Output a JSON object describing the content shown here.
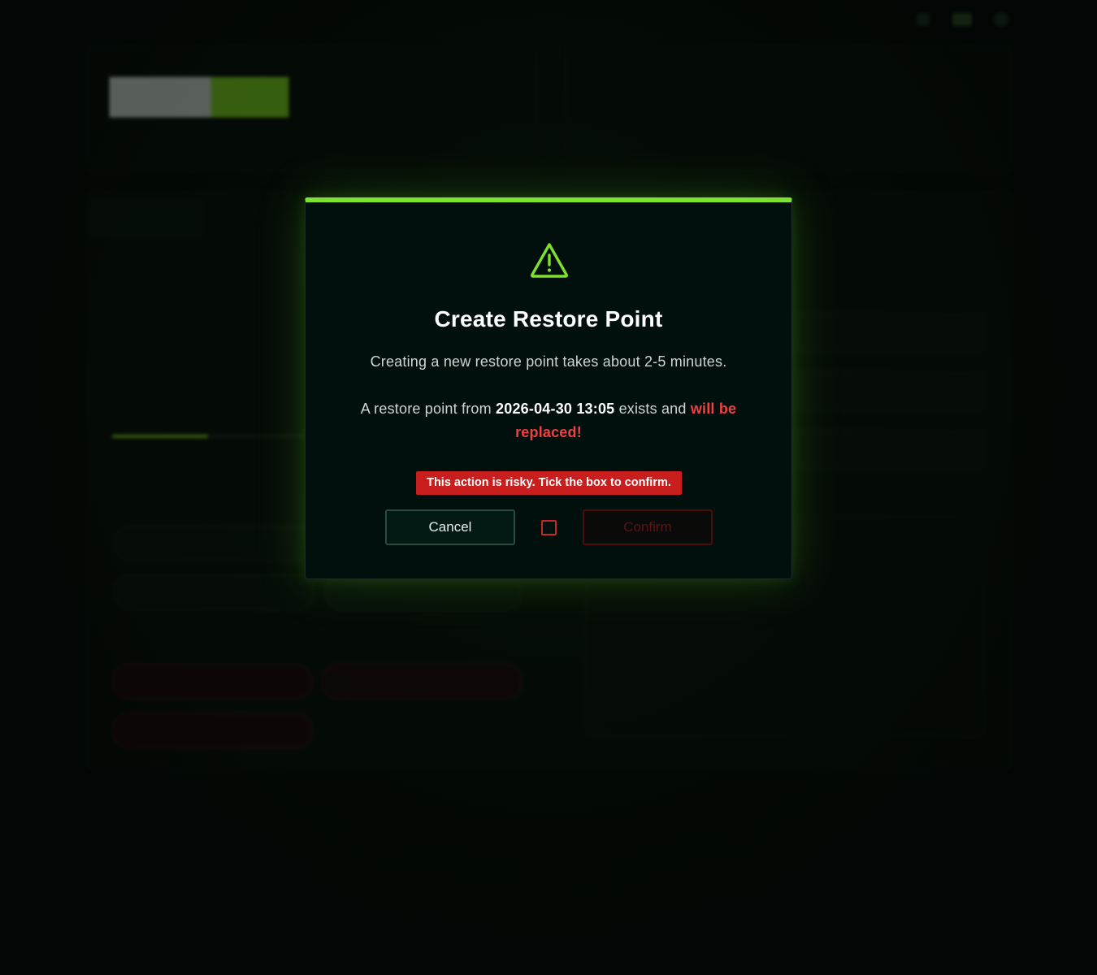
{
  "modal": {
    "icon": "warning-triangle-icon",
    "title": "Create Restore Point",
    "description": "Creating a new restore point takes about 2-5 minutes.",
    "existing_prefix": "A restore point from",
    "existing_timestamp": "2026-04-30 13:05",
    "existing_middle": "exists and",
    "existing_warning": "will be replaced!",
    "risk_notice": "This action is risky. Tick the box to confirm.",
    "cancel_label": "Cancel",
    "confirm_label": "Confirm",
    "confirm_checked": false,
    "confirm_enabled": false
  },
  "colors": {
    "accent": "#7ee02f",
    "danger": "#c81e1e",
    "danger_text": "#ef4040",
    "modal_bg": "#02100d"
  }
}
